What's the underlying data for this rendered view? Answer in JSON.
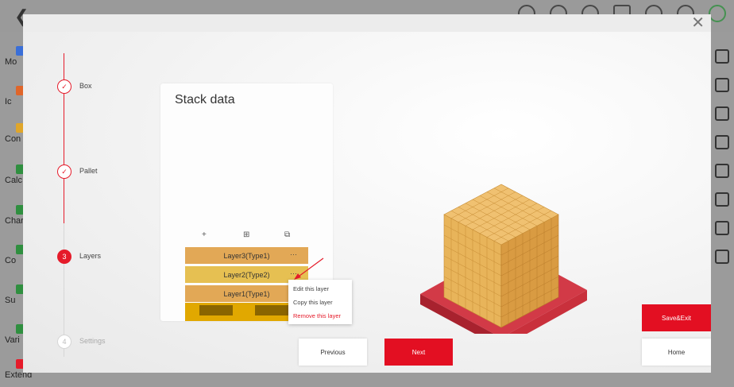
{
  "background_app": {
    "left_menu": [
      "Mo",
      "Ic",
      "Con",
      "Calc",
      "Char",
      "Co",
      "Su",
      "Vari",
      "Extend"
    ]
  },
  "stepper": {
    "steps": [
      {
        "number": "",
        "label": "Box",
        "state": "done"
      },
      {
        "number": "",
        "label": "Pallet",
        "state": "done"
      },
      {
        "number": "3",
        "label": "Layers",
        "state": "active"
      },
      {
        "number": "4",
        "label": "Settings",
        "state": "todo"
      }
    ]
  },
  "stack_panel": {
    "title": "Stack data",
    "tools": {
      "add": "+",
      "grid": "⊞",
      "copy": "⧉"
    },
    "layers": [
      {
        "label": "Layer3(Type1)",
        "menu": "···",
        "color": "#e2a856"
      },
      {
        "label": "Layer2(Type2)",
        "menu": "···",
        "color": "#e6c052"
      },
      {
        "label": "Layer1(Type1)",
        "menu": "···",
        "color": "#e2a856"
      }
    ]
  },
  "context_menu": {
    "items": [
      {
        "label": "Edit this layer"
      },
      {
        "label": "Copy this layer"
      },
      {
        "label": "Remove this layer"
      }
    ]
  },
  "buttons": {
    "previous": "Previous",
    "next": "Next",
    "save_exit": "Save&Exit",
    "home": "Home"
  },
  "colors": {
    "accent": "#e51b2a",
    "box": "#e6b764",
    "pallet": "#c9303c"
  }
}
